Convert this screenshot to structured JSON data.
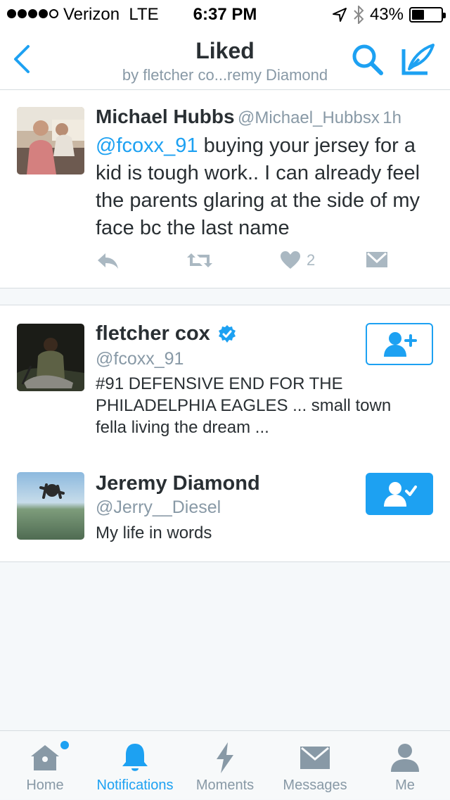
{
  "status_bar": {
    "carrier": "Verizon",
    "network": "LTE",
    "time": "6:37 PM",
    "battery": "43%",
    "battery_level": 0.43,
    "signal_bars": 4
  },
  "header": {
    "title": "Liked",
    "subtitle": "by fletcher co...remy Diamond"
  },
  "tweet": {
    "name": "Michael Hubbs",
    "handle": "@Michael_Hubbsx",
    "time": "1h",
    "mention": "@fcoxx_91",
    "text": " buying your jersey for a kid is tough work.. I can already feel the parents glaring at the side of my face bc the last name",
    "like_count": "2"
  },
  "users": [
    {
      "name": "fletcher cox",
      "handle": "@fcoxx_91",
      "verified": true,
      "bio_line1": "#91 DEFENSIVE END FOR THE",
      "bio_line2": "PHILADELPHIA EAGLES ... small town",
      "bio_line3": "fella living the dream ...",
      "following": false
    },
    {
      "name": "Jeremy Diamond",
      "handle": "@Jerry__Diesel",
      "bio": "My life in words",
      "following": true
    }
  ],
  "tabs": [
    {
      "label": "Home",
      "icon": "home-icon",
      "active": false,
      "badge": true
    },
    {
      "label": "Notifications",
      "icon": "bell-icon",
      "active": true
    },
    {
      "label": "Moments",
      "icon": "lightning-icon",
      "active": false
    },
    {
      "label": "Messages",
      "icon": "envelope-icon",
      "active": false
    },
    {
      "label": "Me",
      "icon": "person-icon",
      "active": false
    }
  ],
  "colors": {
    "accent": "#1da1f2",
    "muted": "#8899a6",
    "icon_gray": "#aab8c2",
    "background": "#f5f8fa"
  }
}
